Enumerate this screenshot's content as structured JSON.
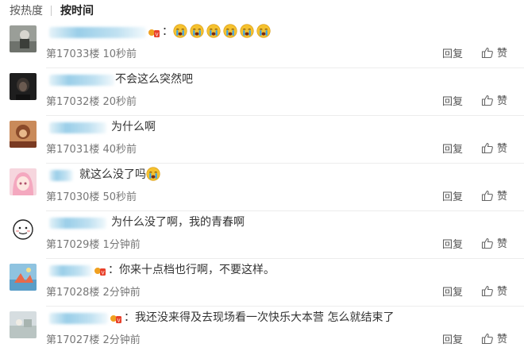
{
  "sort_tabs": [
    {
      "label": "按热度",
      "active": false
    },
    {
      "label": "按时间",
      "active": true
    }
  ],
  "actions": {
    "reply_label": "回复",
    "like_label": "赞",
    "like_icon": "thumbs-up-icon"
  },
  "colors": {
    "name_blur": "#8fcbe6",
    "emoji_face": "#f5c12e",
    "tear": "#3da5e8",
    "text": "#333333",
    "meta": "#777777"
  },
  "comments": [
    {
      "floor": "第17033楼",
      "time": "10秒前",
      "text": "：",
      "emoji": [
        "crying-face-icon",
        "crying-face-icon",
        "crying-face-icon",
        "crying-face-icon",
        "crying-face-icon",
        "crying-face-icon"
      ],
      "vip_badge": true,
      "avatar": "avatar-gray-photo"
    },
    {
      "floor": "第17032楼",
      "time": "20秒前",
      "text": "不会这么突然吧",
      "emoji": [],
      "vip_badge": false,
      "avatar": "avatar-dark-portrait"
    },
    {
      "floor": "第17031楼",
      "time": "40秒前",
      "text": "为什么啊",
      "emoji": [],
      "vip_badge": false,
      "avatar": "avatar-warm-photo"
    },
    {
      "floor": "第17030楼",
      "time": "50秒前",
      "text": "就这么没了吗",
      "emoji": [
        "crying-face-icon"
      ],
      "vip_badge": false,
      "avatar": "avatar-pink-anime"
    },
    {
      "floor": "第17029楼",
      "time": "1分钟前",
      "text": "为什么没了啊，我的青春啊",
      "emoji": [],
      "vip_badge": false,
      "avatar": "avatar-doodle-face"
    },
    {
      "floor": "第17028楼",
      "time": "2分钟前",
      "text": "：你来十点档也行啊，不要这样。",
      "emoji": [],
      "vip_badge": true,
      "avatar": "avatar-blue-art"
    },
    {
      "floor": "第17027楼",
      "time": "2分钟前",
      "text": "：我还没来得及去现场看一次快乐大本营 怎么就结束了",
      "emoji": [],
      "vip_badge": true,
      "avatar": "avatar-pale-scene"
    }
  ]
}
